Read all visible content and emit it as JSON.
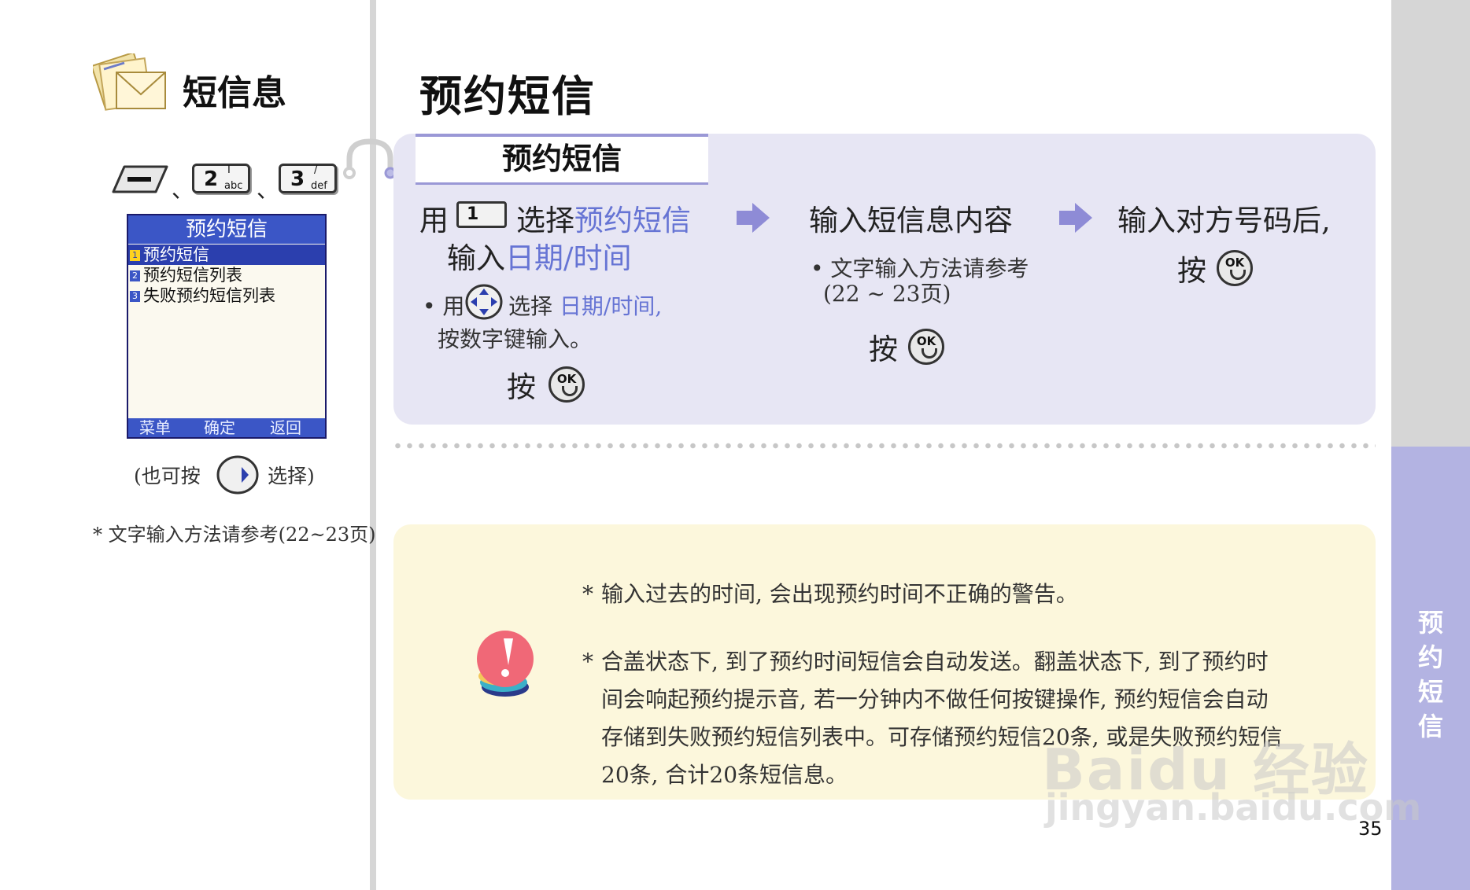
{
  "header": {
    "section_title": "短信息",
    "page_title": "预约短信"
  },
  "keys": {
    "menu_key": "",
    "key2_digit": "2",
    "key2_letters": "abc",
    "key2_top": "I",
    "key3_digit": "3",
    "key3_letters": "def",
    "key3_top": "/",
    "separator": "、"
  },
  "phone_screen": {
    "title": "预约短信",
    "items": [
      {
        "num": "1",
        "label": "预约短信"
      },
      {
        "num": "2",
        "label": "预约短信列表"
      },
      {
        "num": "3",
        "label": "失败预约短信列表"
      }
    ],
    "softkeys": [
      "菜单",
      "确定",
      "返回"
    ]
  },
  "left_notes": {
    "also_press_before": "(也可按",
    "also_press_after": "选择)",
    "reference": "* 文字输入方法请参考(22~23页)"
  },
  "steps": {
    "tab_label": "预约短信",
    "step1": {
      "line1_prefix": "用",
      "key_label": "1",
      "line1_mid": "选择",
      "line1_highlight": "预约短信",
      "line2_prefix": "输入",
      "line2_highlight": "日期/时间",
      "bullet_prefix": "• 用",
      "bullet_mid": "选择",
      "bullet_highlight": "日期/时间,",
      "bullet_line2": "按数字键输入。",
      "press": "按",
      "ok": "OK"
    },
    "step2": {
      "line1": "输入短信息内容",
      "bullet_line1": "• 文字输入方法请参考",
      "bullet_line2": "(22 ~ 23页)",
      "press": "按",
      "ok": "OK"
    },
    "step3": {
      "line1": "输入对方号码后,",
      "press": "按",
      "ok": "OK"
    }
  },
  "notes": {
    "star": "*",
    "note1": "输入过去的时间, 会出现预约时间不正确的警告。",
    "note2_lines": [
      "合盖状态下, 到了预约时间短信会自动发送。翻盖状态下, 到了预约时",
      "间会响起预约提示音, 若一分钟内不做任何按键操作, 预约短信会自动",
      "存储到失败预约短信列表中。可存储预约短信20条, 或是失败预约短信",
      "20条, 合计20条短信息。"
    ]
  },
  "side_tab": {
    "label": [
      "预",
      "约",
      "短",
      "信"
    ]
  },
  "page_number": "35",
  "watermark": {
    "line1": "Baidu 经验",
    "line2": "jingyan.baidu.com"
  },
  "colors": {
    "accent_text": "#6674d4",
    "panel": "#e7e6f4",
    "note_panel": "#fcf7dc",
    "side_tab": "#b3b3e2",
    "phone_blue": "#3b56c6"
  }
}
